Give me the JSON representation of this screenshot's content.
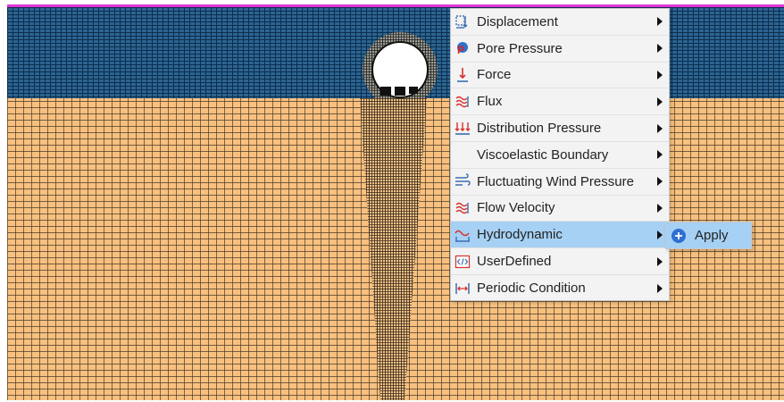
{
  "context_menu": {
    "items": [
      {
        "label": "Displacement",
        "icon": "displacement-icon",
        "has_submenu": true
      },
      {
        "label": "Pore Pressure",
        "icon": "pore-pressure-icon",
        "has_submenu": true
      },
      {
        "label": "Force",
        "icon": "force-icon",
        "has_submenu": true
      },
      {
        "label": "Flux",
        "icon": "flux-icon",
        "has_submenu": true
      },
      {
        "label": "Distribution Pressure",
        "icon": "distribution-pressure-icon",
        "has_submenu": true
      },
      {
        "label": "Viscoelastic Boundary",
        "icon": "",
        "has_submenu": true
      },
      {
        "label": "Fluctuating Wind Pressure",
        "icon": "wind-pressure-icon",
        "has_submenu": true
      },
      {
        "label": "Flow Velocity",
        "icon": "flow-velocity-icon",
        "has_submenu": true
      },
      {
        "label": "Hydrodynamic",
        "icon": "hydrodynamic-icon",
        "has_submenu": true,
        "active": true
      },
      {
        "label": "UserDefined",
        "icon": "user-defined-icon",
        "has_submenu": true
      },
      {
        "label": "Periodic Condition",
        "icon": "periodic-condition-icon",
        "has_submenu": true
      }
    ]
  },
  "submenu": {
    "items": [
      {
        "label": "Apply",
        "icon": "apply-icon"
      }
    ]
  },
  "colors": {
    "mesh_water": "#1f4f7a",
    "mesh_soil": "#f8c07f",
    "border_top": "#e234d6",
    "menu_bg": "#f3f3f3",
    "menu_active": "#a6d0f4"
  }
}
